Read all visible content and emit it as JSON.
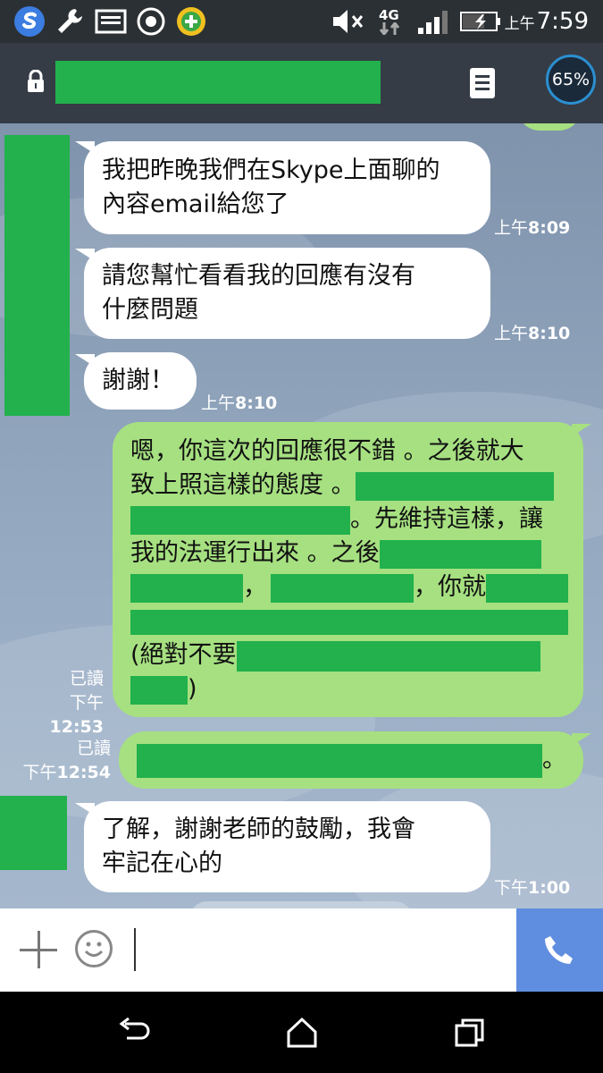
{
  "status_bar": {
    "network_label": "4G",
    "ampm": "上午",
    "time": "7:59",
    "icons": [
      "s-logo-icon",
      "wrench-icon",
      "picture-icon",
      "record-icon",
      "plus-badge-icon",
      "mute-icon",
      "signal-icon",
      "battery-charging-icon"
    ]
  },
  "header": {
    "battery_badge": "65%",
    "lock_icon": "lock-icon",
    "menu_icon": "menu-icon"
  },
  "messages": [
    {
      "side": "in",
      "lines": [
        "我把昨晚我們在Skype上面聊的",
        "內容email給您了"
      ],
      "time_ampm": "上午",
      "time": "8:09"
    },
    {
      "side": "in",
      "lines": [
        "請您幫忙看看我的回應有沒有",
        "什麼問題"
      ],
      "time_ampm": "上午",
      "time": "8:10"
    },
    {
      "side": "in",
      "lines": [
        "謝謝！"
      ],
      "time_ampm": "上午",
      "time": "8:10"
    },
    {
      "side": "out",
      "read_label": "已讀",
      "time_ampm": "下午",
      "time": "12:53",
      "segments": {
        "l1": "嗯，你這次的回應很不錯 。之後就大",
        "l2": "致上照這樣的態度 。",
        "l3": "。先維持這樣，讓",
        "l4": "我的法運行出來 。之後",
        "l5a": "，",
        "l5b": "，你就",
        "l7": "(絕對不要",
        "l8": ")"
      }
    },
    {
      "side": "out",
      "read_label": "已讀",
      "time_ampm": "下午",
      "time": "12:54",
      "tail_text": "。"
    },
    {
      "side": "in",
      "lines": [
        "了解，謝謝老師的鼓勵，我會",
        "牢記在心的"
      ],
      "time_ampm": "下午",
      "time": "1:00"
    }
  ],
  "input_bar": {
    "add_icon": "plus-icon",
    "emoji_icon": "smiley-icon",
    "call_icon": "phone-icon"
  },
  "nav_bar": {
    "icons": [
      "back-icon",
      "home-icon",
      "recents-icon"
    ]
  },
  "colors": {
    "status_bar": "#2b3034",
    "header": "#353c46",
    "redaction": "#22b14c",
    "incoming_bubble": "#ffffff",
    "outgoing_bubble": "#a6e081",
    "call_button": "#5f8ee0"
  }
}
